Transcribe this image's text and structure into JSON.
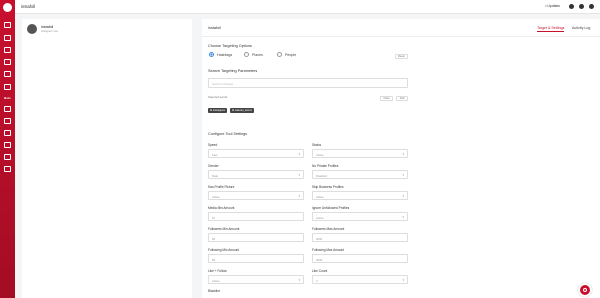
{
  "topbar": {
    "title": "instafoll",
    "update_label": "• Updates"
  },
  "account": {
    "name": "instafoll",
    "subtitle": "Instagram now"
  },
  "sidebar": {
    "text_item": "Bots"
  },
  "main": {
    "title": "instafoll",
    "tabs": [
      "Target & Settings",
      "Activity Log"
    ],
    "targeting_title": "Choose Targeting Options",
    "targeting_options": [
      "Hashtags",
      "Places",
      "People"
    ],
    "reset_label": "Reset",
    "search_title": "Search Targeting Parameters",
    "search_placeholder": "Search hashtags",
    "selected_caption": "Selected words:",
    "clear_label": "Clear",
    "add_label": "Add",
    "chips": [
      "✖ travelgram",
      "✖ natures_lovers"
    ],
    "config_title": "Configure Tool Settings",
    "fields": [
      {
        "label": "Speed",
        "value": "Fast"
      },
      {
        "label": "Status",
        "value": "Active"
      },
      {
        "label": "Gender",
        "value": "Male"
      },
      {
        "label": "No Private Profiles",
        "value": "Disabled"
      },
      {
        "label": "Has Profile Picture",
        "value": "Active"
      },
      {
        "label": "Skip Business Profiles",
        "value": "Active"
      },
      {
        "label": "Media Min Amount",
        "value": "10"
      },
      {
        "label": "Ignore Unfollowed Profiles",
        "value": "Active"
      },
      {
        "label": "Followers Min Amount",
        "value": "50"
      },
      {
        "label": "Followers Max Amount",
        "value": "2000"
      },
      {
        "label": "Following Min Amount",
        "value": "50"
      },
      {
        "label": "Following Max Amount",
        "value": "2000"
      },
      {
        "label": "Like + Follow",
        "value": "Active"
      },
      {
        "label": "Like Count",
        "value": "3"
      },
      {
        "label": "Blacklist",
        "value": ""
      }
    ]
  },
  "colors": {
    "accent": "#c8102e",
    "radio": "#3a8ddd"
  }
}
